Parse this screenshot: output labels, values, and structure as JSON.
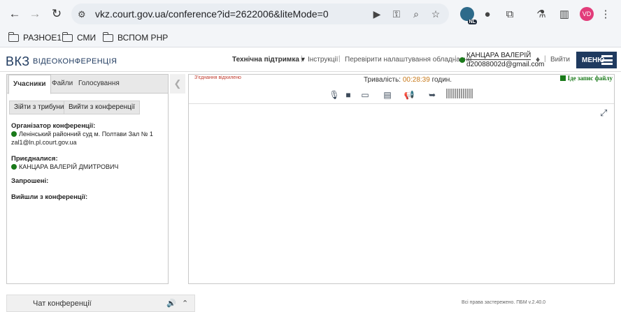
{
  "browser": {
    "url": "vkz.court.gov.ua/conference?id=2622006&liteMode=0",
    "ext_badge": "NL",
    "profile_initials": "VD",
    "bookmarks": [
      "РАЗНОЕ1",
      "СМИ",
      "ВСПОМ PHP"
    ]
  },
  "header": {
    "logo": "ВКЗ",
    "logo_sub": "ВІДЕОКОНФЕРЕНЦІЯ",
    "support": "Технічна підтримка ▾",
    "instructions": "Інструкції",
    "check_settings": "Перевірити налаштування обладнання",
    "user_name": "КАНЦАРА ВАЛЕРІЙ",
    "user_email": "d20088002d@gmail.com",
    "logout": "Вийти",
    "menu": "МЕНЮ",
    "separator": "|"
  },
  "left_panel": {
    "tabs": [
      "Учасники",
      "Файли",
      "Голосування"
    ],
    "buttons": {
      "to_tribune": "Зійти з трибуни",
      "leave": "Вийти з конференції"
    },
    "organizer_title": "Організатор конференції:",
    "organizer_name": "Ленінський районний суд м. Полтави Зал № 1",
    "organizer_email": "zal1@ln.pl.court.gov.ua",
    "joined_title": "Приєдналися:",
    "joined_name": "КАНЦАРА ВАЛЕРІЙ ДМИТРОВИЧ",
    "invited_title": "Запрошені:",
    "left_title": "Вийшли з конференції:"
  },
  "conference": {
    "rejection": "З'єднання відхилено",
    "duration_label": "Тривалість:",
    "duration_value": "00:28:39",
    "duration_unit": "годин.",
    "recording": "Іде запис файлу"
  },
  "footer": {
    "chat": "Чат конференції",
    "rights": "Всі права застережено. ПБМ v.2.40.0"
  },
  "colors": {
    "brand": "#1f3a5f",
    "online": "#1a7a1a",
    "duration": "#c87a1b",
    "alert": "#c0392b"
  }
}
